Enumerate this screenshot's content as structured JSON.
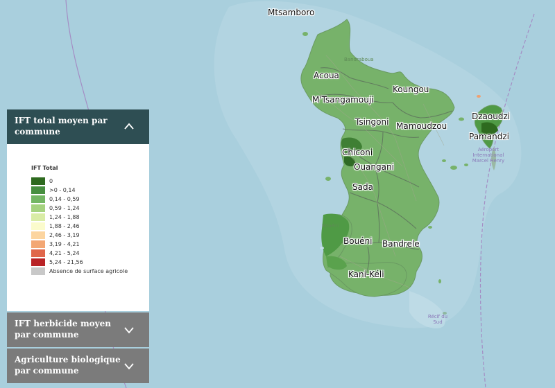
{
  "map": {
    "towns": [
      {
        "name": "Mtsamboro"
      },
      {
        "name": "Acoua"
      },
      {
        "name": "M'Tsangamouji"
      },
      {
        "name": "Koungou"
      },
      {
        "name": "Tsingoni"
      },
      {
        "name": "Mamoudzou"
      },
      {
        "name": "Dzaoudzi"
      },
      {
        "name": "Pamandzi"
      },
      {
        "name": "Chiconi"
      },
      {
        "name": "Ouangani"
      },
      {
        "name": "Sada"
      },
      {
        "name": "Bouéni"
      },
      {
        "name": "Bandrele"
      },
      {
        "name": "Kani-Kéli"
      }
    ],
    "small_labels": {
      "airport": "Aéroport International Marcel Henry",
      "recif": "Récif du Sud",
      "bandraboua": "Bandraboua",
      "boueni_small": "Bouéni"
    },
    "colors": {
      "sea": "#a9cfdd",
      "land": "#77b26a",
      "land_dark": "#3f8a3f",
      "border": "#5c6f5c"
    }
  },
  "panel": {
    "sections": [
      {
        "title": "IFT total moyen par commune",
        "expanded": true,
        "icon": "chevron-up-icon"
      },
      {
        "title": "IFT herbicide moyen par commune",
        "expanded": false,
        "icon": "chevron-down-icon"
      },
      {
        "title": "Agriculture biologique par commune",
        "expanded": false,
        "icon": "chevron-down-icon"
      }
    ],
    "legend": {
      "title": "IFT Total",
      "items": [
        {
          "label": "0",
          "color": "#2e6a1f"
        },
        {
          "label": ">0  - 0,14",
          "color": "#478f40"
        },
        {
          "label": "0,14 - 0,59",
          "color": "#73b663"
        },
        {
          "label": "0,59 - 1,24",
          "color": "#a5d27f"
        },
        {
          "label": "1,24 - 1,88",
          "color": "#d9eca6"
        },
        {
          "label": "1,88 - 2,46",
          "color": "#fbfbcc"
        },
        {
          "label": "2,46 - 3,19",
          "color": "#fcd5a0"
        },
        {
          "label": "3,19 - 4,21",
          "color": "#f3a774"
        },
        {
          "label": "4,21 - 5,24",
          "color": "#e0674b"
        },
        {
          "label": "5,24 - 21,56",
          "color": "#b82326"
        },
        {
          "label": "Absence de surface agricole",
          "color": "#c8c8c8"
        }
      ]
    }
  }
}
